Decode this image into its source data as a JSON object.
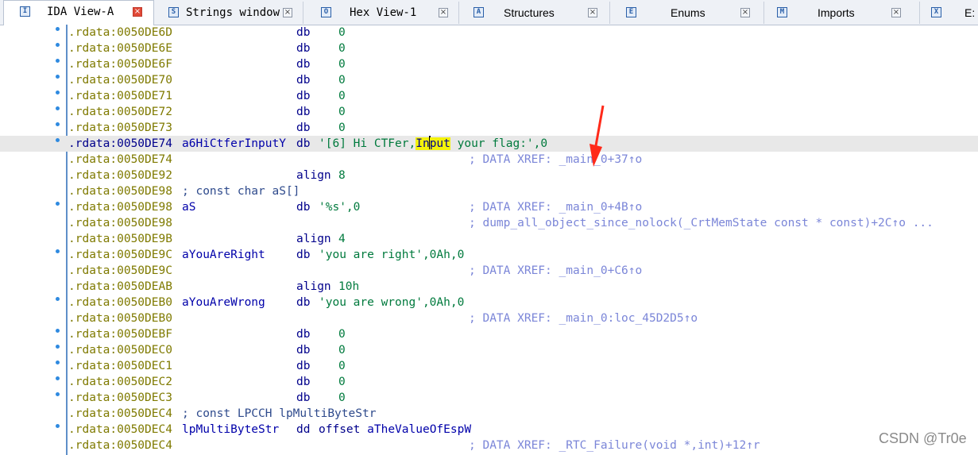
{
  "tabs": [
    {
      "label": "IDA View-A",
      "icon": "I",
      "active": true
    },
    {
      "label": "Strings window",
      "icon": "S",
      "active": false
    },
    {
      "label": "Hex View-1",
      "icon": "O",
      "active": false
    },
    {
      "label": "Structures",
      "icon": "A",
      "active": false
    },
    {
      "label": "Enums",
      "icon": "E",
      "active": false
    },
    {
      "label": "Imports",
      "icon": "M",
      "active": false
    },
    {
      "label": "E:",
      "icon": "X",
      "active": false
    }
  ],
  "close_glyph": "×",
  "lines": [
    {
      "addr": ".rdata:0050DE6D",
      "mn": "db",
      "op": "0"
    },
    {
      "addr": ".rdata:0050DE6E",
      "mn": "db",
      "op": "0"
    },
    {
      "addr": ".rdata:0050DE6F",
      "mn": "db",
      "op": "0"
    },
    {
      "addr": ".rdata:0050DE70",
      "mn": "db",
      "op": "0"
    },
    {
      "addr": ".rdata:0050DE71",
      "mn": "db",
      "op": "0"
    },
    {
      "addr": ".rdata:0050DE72",
      "mn": "db",
      "op": "0"
    },
    {
      "addr": ".rdata:0050DE73",
      "mn": "db",
      "op": "0"
    },
    {
      "addr": ".rdata:0050DE74",
      "name": "a6HiCtferInputY",
      "mn": "db",
      "str_a": "'[6] Hi CTFer,",
      "str_hl_a": "In",
      "str_hl_b": "put",
      "str_b": " your flag:'",
      "num": ",0"
    },
    {
      "addr": ".rdata:0050DE74",
      "xref": "; DATA XREF: _main_0+37↑o"
    },
    {
      "addr": ".rdata:0050DE92",
      "mn": "align",
      "op": "8"
    },
    {
      "addr": ".rdata:0050DE98",
      "cmt": "; const char aS[]"
    },
    {
      "addr": ".rdata:0050DE98",
      "name": "aS",
      "mn": "db",
      "strw": "'%s'",
      "num": ",0",
      "xref": "; DATA XREF: _main_0+4B↑o"
    },
    {
      "addr": ".rdata:0050DE98",
      "xref": "; dump_all_object_since_nolock(_CrtMemState const * const)+2C↑o ..."
    },
    {
      "addr": ".rdata:0050DE9B",
      "mn": "align",
      "op": "4"
    },
    {
      "addr": ".rdata:0050DE9C",
      "name": "aYouAreRight",
      "mn": "db",
      "strw": "'you are right'",
      "num": ",0Ah,0"
    },
    {
      "addr": ".rdata:0050DE9C",
      "xref": "; DATA XREF: _main_0+C6↑o"
    },
    {
      "addr": ".rdata:0050DEAB",
      "mn": "align",
      "op": "10h"
    },
    {
      "addr": ".rdata:0050DEB0",
      "name": "aYouAreWrong",
      "mn": "db",
      "strw": "'you are wrong'",
      "num": ",0Ah,0"
    },
    {
      "addr": ".rdata:0050DEB0",
      "xref": "; DATA XREF: _main_0:loc_45D2D5↑o"
    },
    {
      "addr": ".rdata:0050DEBF",
      "mn": "db",
      "op": "0"
    },
    {
      "addr": ".rdata:0050DEC0",
      "mn": "db",
      "op": "0"
    },
    {
      "addr": ".rdata:0050DEC1",
      "mn": "db",
      "op": "0"
    },
    {
      "addr": ".rdata:0050DEC2",
      "mn": "db",
      "op": "0"
    },
    {
      "addr": ".rdata:0050DEC3",
      "mn": "db",
      "op": "0"
    },
    {
      "addr": ".rdata:0050DEC4",
      "cmt": "; const LPCCH lpMultiByteStr"
    },
    {
      "addr": ".rdata:0050DEC4",
      "name": "lpMultiByteStr",
      "mn": "dd",
      "off_kw": "offset",
      "off_name": "aTheValueOfEspW"
    },
    {
      "addr": ".rdata:0050DEC4",
      "xref": "; DATA XREF: _RTC_Failure(void *,int)+12↑r"
    }
  ],
  "watermark": "CSDN @Tr0e",
  "colors": {
    "address": "#7f7a00",
    "highlight": "#f3f20a",
    "arrow": "#ff2a1a",
    "current_line": "#e8e8e8"
  }
}
